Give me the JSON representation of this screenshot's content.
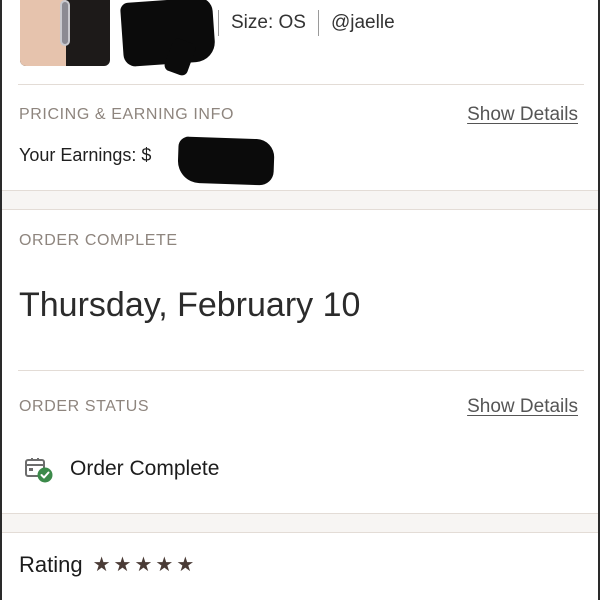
{
  "item": {
    "size_label": "Size: OS",
    "seller": "@jaelle"
  },
  "pricing": {
    "section_title": "PRICING & EARNING INFO",
    "show_details": "Show Details",
    "earnings_label": "Your Earnings: $"
  },
  "order_complete": {
    "section_title": "ORDER COMPLETE",
    "date": "Thursday, February 10"
  },
  "order_status": {
    "section_title": "ORDER STATUS",
    "show_details": "Show Details",
    "status_text": "Order Complete",
    "status_icon": "package-check-icon",
    "status_color": "#3b8a4a"
  },
  "rating": {
    "label": "Rating",
    "stars": 5,
    "star_color": "#4a3b36"
  }
}
